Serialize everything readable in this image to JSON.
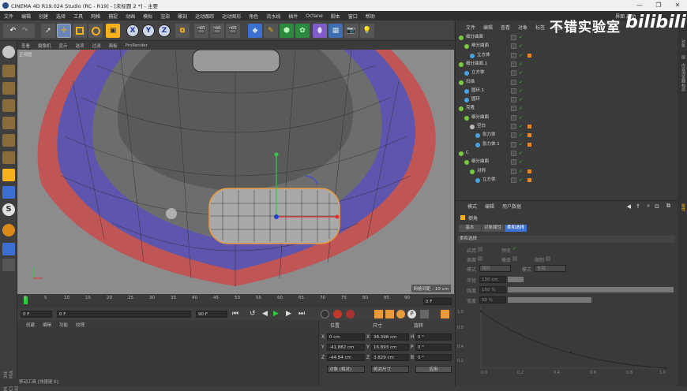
{
  "window": {
    "title": "CINEMA 4D R19.024 Studio (RC - R19) - [未标题 2 *] - 主要",
    "buttons": [
      "—",
      "❐",
      "✕"
    ]
  },
  "menu": [
    "文件",
    "编辑",
    "创建",
    "选择",
    "工具",
    "网格",
    "捕捉",
    "动画",
    "模拟",
    "渲染",
    "雕刻",
    "运动跟踪",
    "运动图形",
    "角色",
    "流水线",
    "插件",
    "Octane",
    "脚本",
    "窗口",
    "帮助"
  ],
  "layout_label": "界面 启动",
  "watermark": "不错实验室",
  "bili_logo": "bilibili",
  "toolbar": {
    "axes": [
      "X",
      "Y",
      "Z"
    ]
  },
  "viewport_menu": [
    "查看",
    "摄像机",
    "显示",
    "选项",
    "过滤",
    "面板",
    "ProRender"
  ],
  "viewport": {
    "label": "正视图",
    "grid_info": "网格间距 : 10 cm"
  },
  "timeline": {
    "ticks": [
      "0",
      "5",
      "10",
      "15",
      "20",
      "25",
      "30",
      "35",
      "40",
      "45",
      "50",
      "55",
      "60",
      "65",
      "70",
      "75",
      "80",
      "85",
      "90"
    ],
    "end_field": "0 F"
  },
  "transport": {
    "start": "0 F",
    "current": "0 F",
    "max": "90 F",
    "end": "90 F"
  },
  "material_menu": [
    "创建",
    "编辑",
    "功能",
    "纹理"
  ],
  "coordinates": {
    "headers": [
      "位置",
      "尺寸",
      "旋转"
    ],
    "rows": [
      {
        "axis": "X",
        "pos": "0 cm",
        "size": "38.398 cm",
        "rot_label": "H",
        "rot": "0 °"
      },
      {
        "axis": "Y",
        "pos": "-41.882 cm",
        "size": "16.893 cm",
        "rot_label": "P",
        "rot": "0 °"
      },
      {
        "axis": "Z",
        "pos": "-44.84 cm",
        "size": "3.829 cm",
        "rot_label": "B",
        "rot": "0 °"
      }
    ],
    "mode1": "对象 (相对)",
    "mode2": "绝对尺寸",
    "apply": "应用"
  },
  "object_tabs": [
    "文件",
    "编辑",
    "查看",
    "对象",
    "标签",
    "书签"
  ],
  "objects": [
    {
      "name": "细分曲面",
      "indent": 0,
      "color": "#7ac943"
    },
    {
      "name": "细分曲面",
      "indent": 1,
      "color": "#7ac943"
    },
    {
      "name": "立方体",
      "indent": 2,
      "color": "#4aa3e0"
    },
    {
      "name": "细分曲面.1",
      "indent": 0,
      "color": "#7ac943"
    },
    {
      "name": "立方体",
      "indent": 1,
      "color": "#4aa3e0"
    },
    {
      "name": "扫描",
      "indent": 0,
      "color": "#7ac943"
    },
    {
      "name": "圆环.1",
      "indent": 1,
      "color": "#4aa3e0"
    },
    {
      "name": "圆环",
      "indent": 1,
      "color": "#4aa3e0"
    },
    {
      "name": "克隆",
      "indent": 0,
      "color": "#7ac943"
    },
    {
      "name": "细分曲面",
      "indent": 1,
      "color": "#7ac943"
    },
    {
      "name": "空白",
      "indent": 2,
      "color": "#bbbbbb"
    },
    {
      "name": "张力体",
      "indent": 3,
      "color": "#4aa3e0"
    },
    {
      "name": "张力体.1",
      "indent": 3,
      "color": "#4aa3e0"
    },
    {
      "name": "C",
      "indent": 0,
      "color": "#7ac943"
    },
    {
      "name": "细分曲面",
      "indent": 1,
      "color": "#7ac943"
    },
    {
      "name": "对称",
      "indent": 2,
      "color": "#7ac943"
    },
    {
      "name": "立方体",
      "indent": 3,
      "color": "#4aa3e0"
    }
  ],
  "attributes": {
    "menu": [
      "模式",
      "编辑",
      "用户数据"
    ],
    "object_name": "倒角",
    "tabs": [
      "基本",
      "对象属性",
      "柔和选择"
    ],
    "section": "柔和选择",
    "opts_row1": [
      "启用",
      "预览"
    ],
    "opts_row2": [
      "表面",
      "橡皮",
      "限制"
    ],
    "mode_label": "模式",
    "mode_value": "球形",
    "form_label": "模式",
    "form_value": "全部",
    "radius_label": "半径",
    "radius_value": "100 cm",
    "strength_label": "强度",
    "strength_value": "100 %",
    "width_label": "宽度",
    "width_value": "50 %",
    "graph_y": [
      "1.0",
      "0.8",
      "0.4",
      "0.2"
    ],
    "graph_x": [
      "0.0",
      "0.2",
      "0.4",
      "0.6",
      "0.8",
      "1.0"
    ]
  },
  "right_tabs": [
    "对象",
    "层",
    "内容浏览器",
    "构造",
    "属性"
  ],
  "status": "移动工具 [快捷键 E]"
}
